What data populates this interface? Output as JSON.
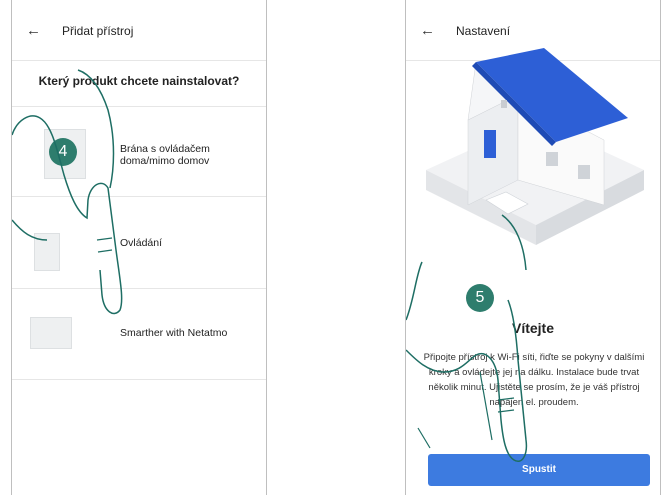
{
  "left_screen": {
    "header": {
      "back_icon": "←",
      "title": "Přidat přístroj"
    },
    "question": "Který produkt chcete nainstalovat?",
    "products": [
      {
        "label": "Brána s ovládačem doma/mimo domov",
        "icon": "gateway-icon"
      },
      {
        "label": "Ovládání",
        "icon": "remote-icon"
      },
      {
        "label": "Smarther with Netatmo",
        "icon": "thermostat-icon"
      }
    ],
    "step_badge": "4"
  },
  "right_screen": {
    "header": {
      "back_icon": "←",
      "title": "Nastavení"
    },
    "welcome_title": "Vítejte",
    "welcome_text": "Připojte přístroj k Wi-Fi síti, řiďte se pokyny v dalšími kroky a ovládejte jej na dálku. Instalace bude trvat několik minut. Ujistěte se prosím, že je váš přístroj napájen el. proudem.",
    "start_button": "Spustit",
    "step_badge": "5"
  },
  "colors": {
    "accent": "#3d7be0",
    "badge": "#2e7d6d",
    "roof": "#2d5fd6"
  }
}
